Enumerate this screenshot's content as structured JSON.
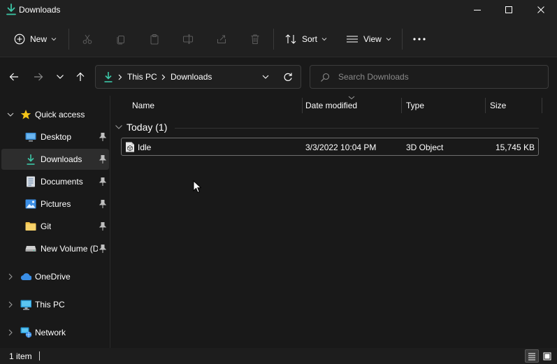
{
  "window": {
    "title": "Downloads"
  },
  "commandbar": {
    "new_label": "New",
    "sort_label": "Sort",
    "view_label": "View"
  },
  "address": {
    "crumbs": [
      "This PC",
      "Downloads"
    ]
  },
  "search": {
    "placeholder": "Search Downloads"
  },
  "sidebar": {
    "quick_access": "Quick access",
    "items": [
      {
        "label": "Desktop",
        "icon": "desktop-icon",
        "pinned": true
      },
      {
        "label": "Downloads",
        "icon": "download-arrow-icon",
        "pinned": true,
        "selected": true
      },
      {
        "label": "Documents",
        "icon": "document-icon",
        "pinned": true
      },
      {
        "label": "Pictures",
        "icon": "pictures-icon",
        "pinned": true
      },
      {
        "label": "Git",
        "icon": "folder-icon",
        "pinned": true
      },
      {
        "label": "New Volume (D",
        "icon": "drive-icon",
        "pinned": true
      }
    ],
    "onedrive": "OneDrive",
    "thispc": "This PC",
    "network": "Network"
  },
  "columns": {
    "name": "Name",
    "date": "Date modified",
    "type": "Type",
    "size": "Size"
  },
  "group": {
    "label": "Today (1)"
  },
  "files": [
    {
      "name": "Idle",
      "date": "3/3/2022 10:04 PM",
      "type": "3D Object",
      "size": "15,745 KB",
      "icon": "3d-object-file-icon"
    }
  ],
  "status": {
    "count": "1 item"
  },
  "colors": {
    "accent_teal": "#3cc7a7",
    "background": "#191919",
    "chrome": "#202020",
    "folder_yellow": "#f2c24c",
    "star_yellow": "#f5c518",
    "onedrive_blue": "#3a8ee6"
  }
}
